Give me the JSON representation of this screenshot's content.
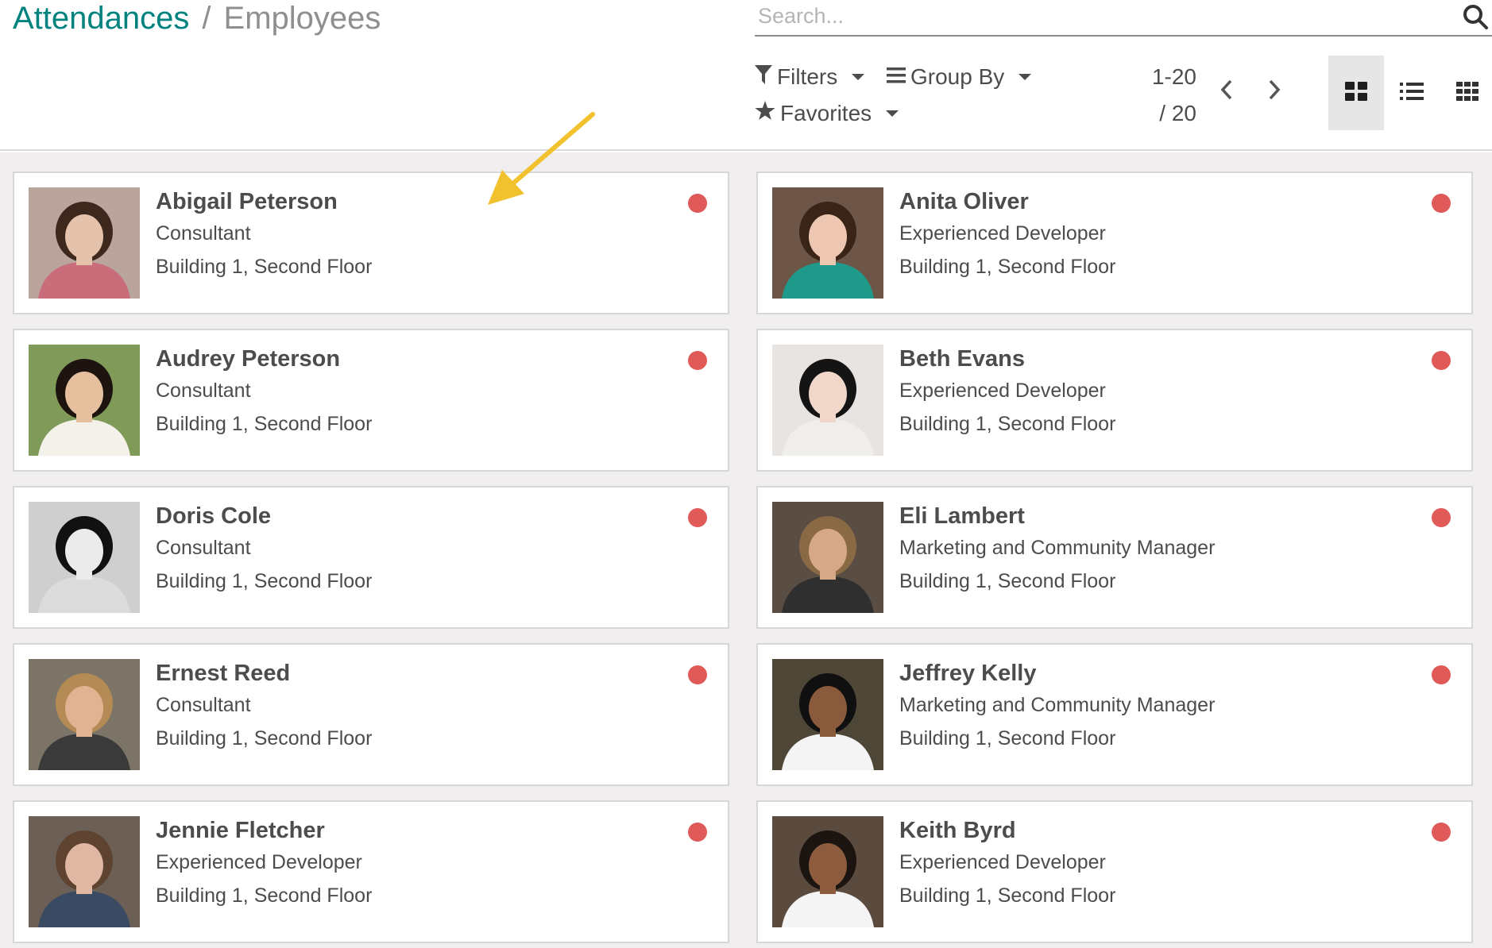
{
  "breadcrumb": {
    "parent": "Attendances",
    "separator": "/",
    "current": "Employees"
  },
  "search": {
    "placeholder": "Search...",
    "icon": "search-icon"
  },
  "toolbar": {
    "filters": "Filters",
    "group_by": "Group By",
    "favorites": "Favorites"
  },
  "pager": {
    "range": "1-20",
    "total": "/ 20"
  },
  "views": {
    "active": "kanban",
    "options": [
      "kanban",
      "list",
      "grid"
    ]
  },
  "colors": {
    "accent": "#00827f",
    "presence_absent": "#e05a5a",
    "annotation_arrow": "#f2c12e"
  },
  "employees": [
    {
      "name": "Abigail Peterson",
      "job": "Consultant",
      "location": "Building 1, Second Floor"
    },
    {
      "name": "Anita Oliver",
      "job": "Experienced Developer",
      "location": "Building 1, Second Floor"
    },
    {
      "name": "Audrey Peterson",
      "job": "Consultant",
      "location": "Building 1, Second Floor"
    },
    {
      "name": "Beth Evans",
      "job": "Experienced Developer",
      "location": "Building 1, Second Floor"
    },
    {
      "name": "Doris Cole",
      "job": "Consultant",
      "location": "Building 1, Second Floor"
    },
    {
      "name": "Eli Lambert",
      "job": "Marketing and Community Manager",
      "location": "Building 1, Second Floor"
    },
    {
      "name": "Ernest Reed",
      "job": "Consultant",
      "location": "Building 1, Second Floor"
    },
    {
      "name": "Jeffrey Kelly",
      "job": "Marketing and Community Manager",
      "location": "Building 1, Second Floor"
    },
    {
      "name": "Jennie Fletcher",
      "job": "Experienced Developer",
      "location": "Building 1, Second Floor"
    },
    {
      "name": "Keith Byrd",
      "job": "Experienced Developer",
      "location": "Building 1, Second Floor"
    }
  ]
}
